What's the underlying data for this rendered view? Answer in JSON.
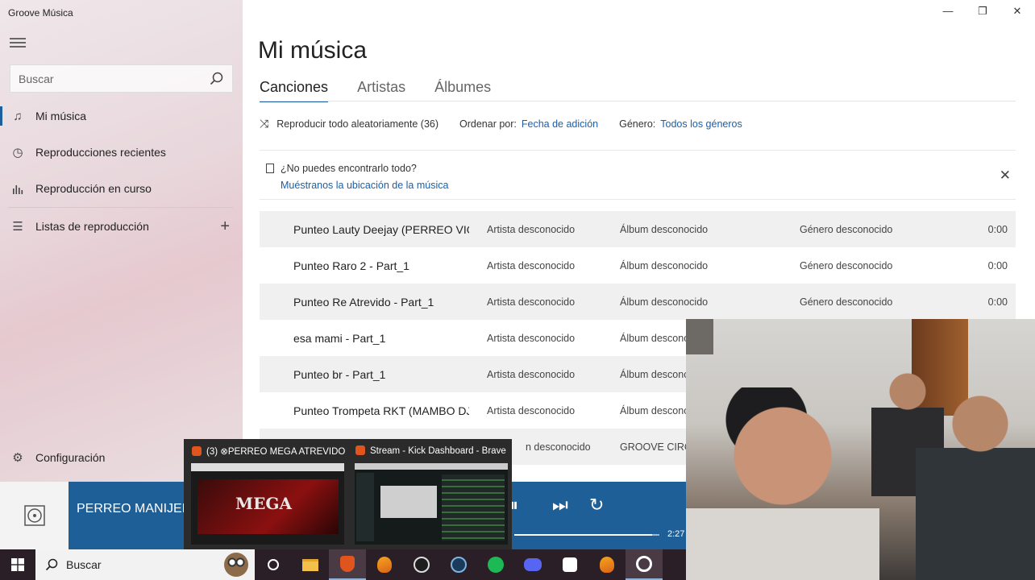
{
  "app": {
    "title": "Groove Música"
  },
  "sidebar": {
    "search_placeholder": "Buscar",
    "items": [
      {
        "label": "Mi música",
        "icon": "music-note-icon"
      },
      {
        "label": "Reproducciones recientes",
        "icon": "clock-icon"
      },
      {
        "label": "Reproducción en curso",
        "icon": "equalizer-icon"
      },
      {
        "label": "Listas de reproducción",
        "icon": "playlist-icon"
      }
    ],
    "settings_label": "Configuración"
  },
  "window_controls": {
    "minimize": "—",
    "restore": "❐",
    "close": "✕"
  },
  "main": {
    "title": "Mi música",
    "tabs": [
      {
        "label": "Canciones"
      },
      {
        "label": "Artistas"
      },
      {
        "label": "Álbumes"
      }
    ],
    "toolbar": {
      "shuffle_label": "Reproducir todo aleatoriamente (36)",
      "sort_label": "Ordenar por:",
      "sort_value": "Fecha de adición",
      "genre_label": "Género:",
      "genre_value": "Todos los géneros"
    },
    "notice": {
      "question": "¿No puedes encontrarlo todo?",
      "link": "Muéstranos la ubicación de la música"
    },
    "songs": [
      {
        "title": "Punteo Lauty Deejay (PERREO VIOL",
        "artist": "Artista desconocido",
        "album": "Álbum desconocido",
        "genre": "Género desconocido",
        "duration": "0:00"
      },
      {
        "title": "Punteo Raro 2 - Part_1",
        "artist": "Artista desconocido",
        "album": "Álbum desconocido",
        "genre": "Género desconocido",
        "duration": "0:00"
      },
      {
        "title": "Punteo Re Atrevido - Part_1",
        "artist": "Artista desconocido",
        "album": "Álbum desconocido",
        "genre": "Género desconocido",
        "duration": "0:00"
      },
      {
        "title": "esa mami - Part_1",
        "artist": "Artista desconocido",
        "album": "Álbum desconoc",
        "genre": "",
        "duration": ""
      },
      {
        "title": "Punteo br - Part_1",
        "artist": "Artista desconocido",
        "album": "Álbum desconoc",
        "genre": "",
        "duration": ""
      },
      {
        "title": "Punteo Trompeta RKT (MAMBO DJ",
        "artist": "Artista desconocido",
        "album": "Álbum desconoc",
        "genre": "",
        "duration": ""
      },
      {
        "title": "",
        "artist": "n desconocido",
        "album": "GROOVE CIRCU",
        "genre": "",
        "duration": ""
      }
    ]
  },
  "player": {
    "now_playing": "PERREO MANIJERO",
    "time": "2:27",
    "progress": 0.95
  },
  "thumbnails": [
    {
      "title": "(3) ⊗PERREO MEGA ATREVIDO ...",
      "preview_text": "MEGA"
    },
    {
      "title": "Stream - Kick Dashboard - Brave"
    }
  ],
  "taskbar": {
    "search_label": "Buscar"
  }
}
